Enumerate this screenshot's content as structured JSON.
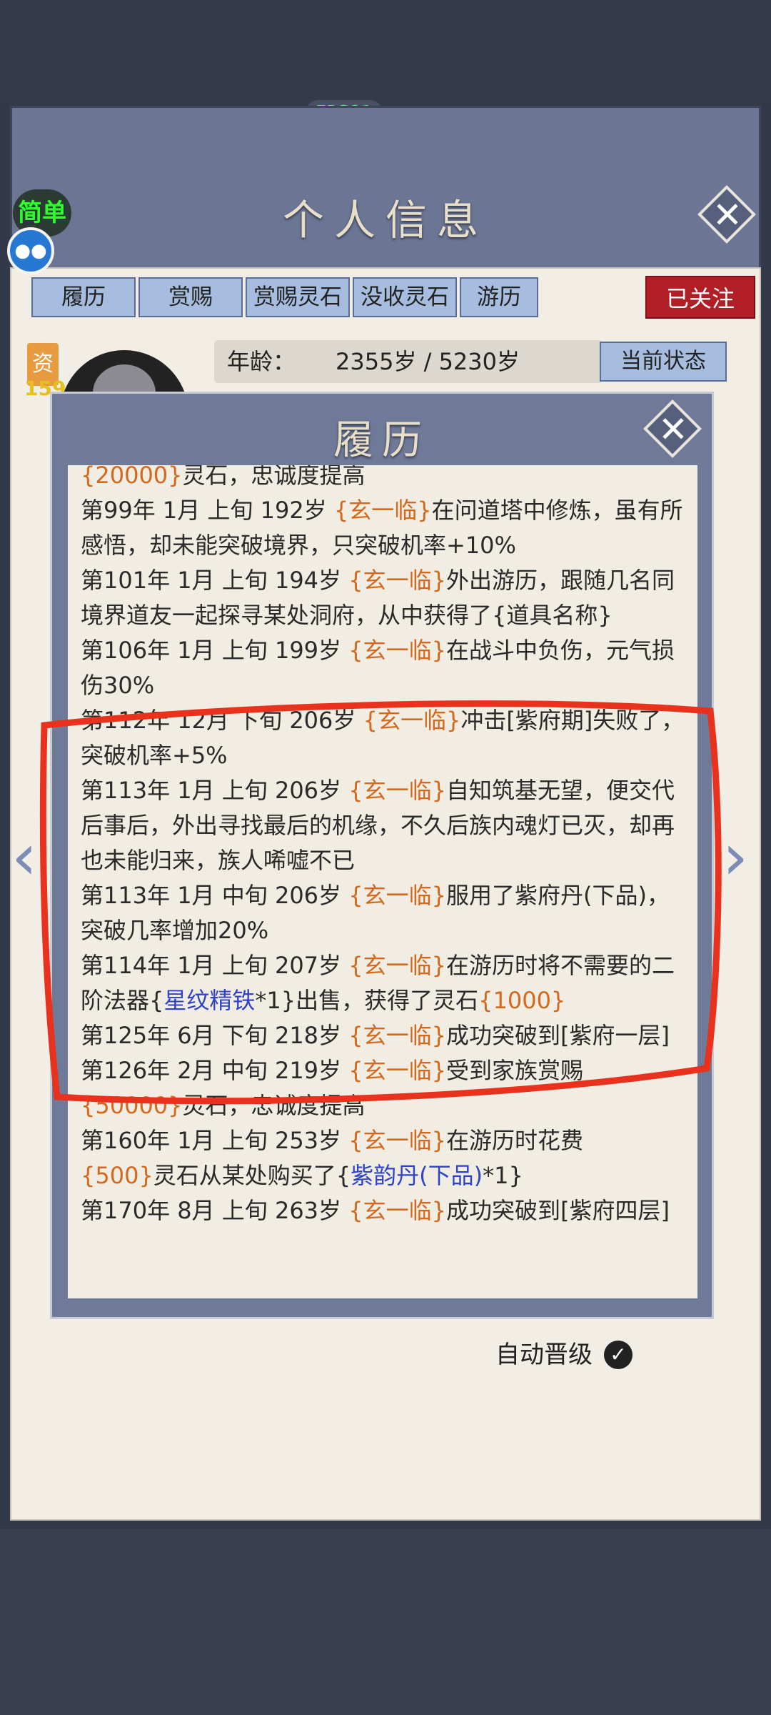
{
  "status": {
    "fps": "FPS81"
  },
  "header": {
    "title": "个人信息",
    "difficulty": "简单",
    "avatar_icon": "chat-bubble-icon"
  },
  "tabs": [
    "履历",
    "赏赐",
    "赏赐灵石",
    "没收灵石",
    "游历"
  ],
  "follow_label": "已关注",
  "profile": {
    "age_label": "年龄：",
    "age_value": "2355岁 / 5230岁",
    "state_button": "当前状态",
    "resource_label": "资",
    "resource_value": "159"
  },
  "auto_promote": {
    "label": "自动晋级",
    "checked": true
  },
  "modal": {
    "title": "履历",
    "entries": [
      {
        "prefix": "",
        "stones": "{20000}",
        "suffix": "灵石，忠诚度提高"
      },
      {
        "prefix": "第99年 1月 上旬  192岁 ",
        "name": "{玄一临}",
        "suffix": "在问道塔中修炼，虽有所感悟，却未能突破境界，只突破机率+10%"
      },
      {
        "prefix": "第101年 1月 上旬  194岁 ",
        "name": "{玄一临}",
        "suffix": "外出游历，跟随几名同境界道友一起探寻某处洞府，从中获得了{道具名称}"
      },
      {
        "prefix": "第106年 1月 上旬  199岁 ",
        "name": "{玄一临}",
        "suffix": "在战斗中负伤，元气损伤30%"
      },
      {
        "prefix": "第112年 12月 下旬  206岁  ",
        "name": "{玄一临}",
        "suffix": "冲击[紫府期]失败了，突破机率+5%"
      },
      {
        "prefix": "第113年 1月 上旬  206岁 ",
        "name": "{玄一临}",
        "suffix": "自知筑基无望，便交代后事后，外出寻找最后的机缘，不久后族内魂灯已灭，却再也未能归来，族人唏嘘不已"
      },
      {
        "prefix": "第113年  1月  中旬   206岁   ",
        "name": "{玄一临}",
        "suffix": "服用了紫府丹(下品)，突破几率增加20%"
      },
      {
        "prefix": "第114年 1月 上旬  207岁 ",
        "name": "{玄一临}",
        "mid": "在游历时将不需要的二阶法器{",
        "item": "星纹精铁",
        "mid2": "*1}出售，获得了灵石",
        "stones": "{1000}"
      },
      {
        "prefix": "第125年 6月 下旬  218岁  ",
        "name": "{玄一临}",
        "suffix": "成功突破到[紫府一层]"
      },
      {
        "prefix": "第126年  2月   中旬    219岁     ",
        "name": "{玄一临}",
        "suffix": "受到家族赏赐",
        "stones2": "{50000}",
        "suffix2": "灵石，忠诚度提高"
      },
      {
        "prefix": "第160年  1月   上旬    253岁     ",
        "name": "{玄一临}",
        "suffix": "在游历时花费",
        "stones2": "{500}",
        "suffix2": "灵石从某处购买了{",
        "item2": "紫韵丹(下品)",
        "suffix3": "*1}"
      },
      {
        "prefix": "第170年  8月  上旬   263岁  ",
        "name": "{玄一临}",
        "suffix": "成功突破到[紫府四层]"
      }
    ]
  },
  "colors": {
    "highlight": "#e8321e",
    "name": "#d2691e",
    "item": "#2f43c8"
  }
}
